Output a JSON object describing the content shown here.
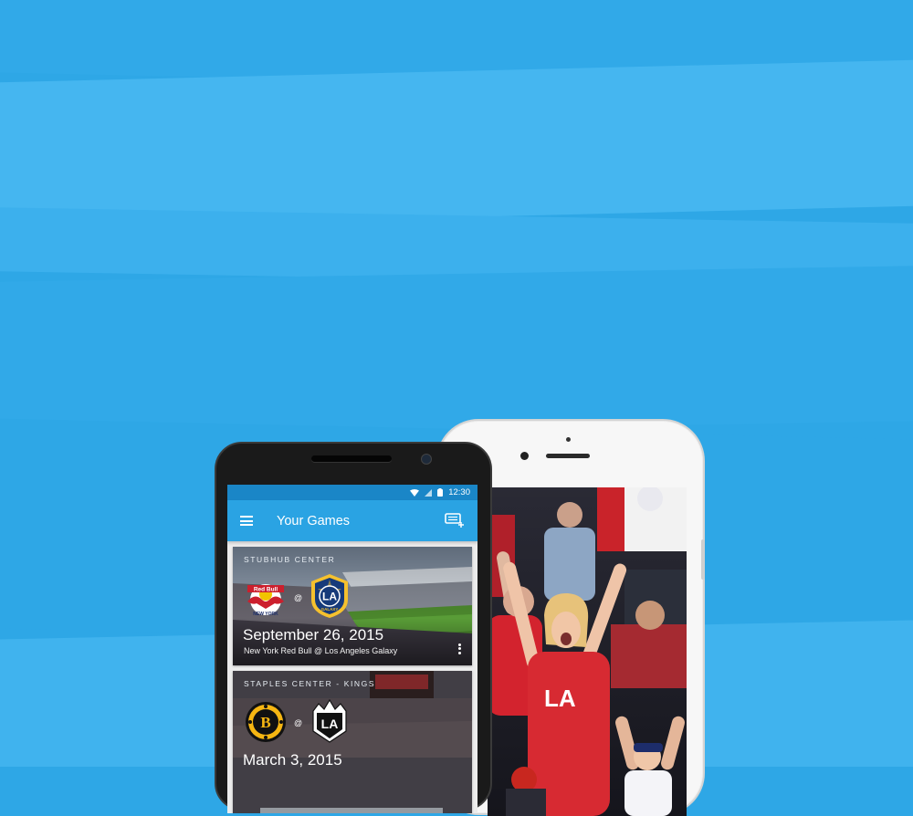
{
  "colors": {
    "background": "#2ea7e6",
    "app_bar": "#2aa3e3",
    "status_bar": "#1a86c7"
  },
  "status_bar": {
    "time": "12:30",
    "icons": [
      "wifi-icon",
      "signal-icon",
      "battery-icon"
    ]
  },
  "app_bar": {
    "title": "Your Games",
    "menu_icon": "menu-icon",
    "action_icon": "add-ticket-icon"
  },
  "games": [
    {
      "venue": "STUBHUB CENTER",
      "home_logo": "ny-red-bull-logo",
      "away_logo": "la-galaxy-logo",
      "at": "@",
      "date": "September 26, 2015",
      "matchup": "New York Red Bull @ Los Angeles Galaxy"
    },
    {
      "venue": "STAPLES CENTER - KINGS",
      "home_logo": "boston-bruins-logo",
      "away_logo": "la-kings-logo",
      "at": "@",
      "date": "March 3, 2015"
    }
  ]
}
